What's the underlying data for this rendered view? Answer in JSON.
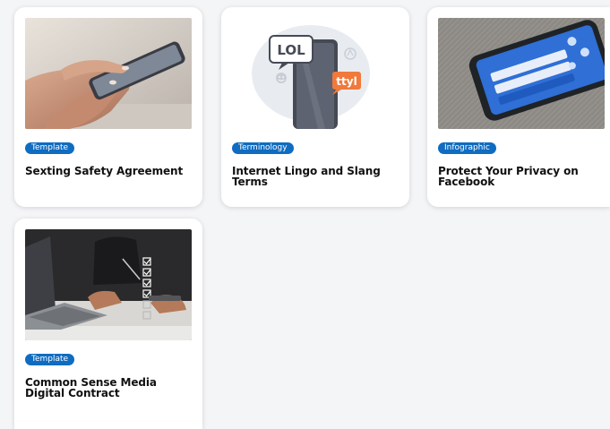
{
  "cards": [
    {
      "tag": "Template",
      "title": "Sexting Safety Agreement",
      "image": "hands-holding-smartphone-photo"
    },
    {
      "tag": "Terminology",
      "title": "Internet Lingo and Slang Terms",
      "image": "phone-chat-bubbles-illustration",
      "bubble_lol": "LOL",
      "bubble_ttyl": "ttyl"
    },
    {
      "tag": "Infographic",
      "title": "Protect Your Privacy on Facebook",
      "image": "phone-facebook-login-photo"
    },
    {
      "tag": "Template",
      "title": "Common Sense Media Digital Contract",
      "image": "person-checklist-laptop-photo"
    }
  ],
  "colors": {
    "tag_bg": "#0f6cc0",
    "tag_text": "#ffffff",
    "title_text": "#111111",
    "card_bg": "#ffffff",
    "page_bg": "#f4f5f7",
    "bubble_ttyl": "#f0793b"
  }
}
